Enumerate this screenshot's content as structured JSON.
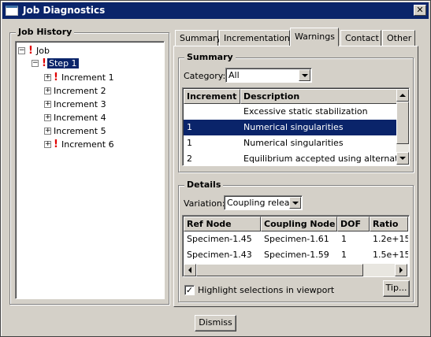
{
  "window": {
    "title": "Job Diagnostics",
    "close_glyph": "✕"
  },
  "job_history": {
    "label": "Job History",
    "tree": {
      "job": {
        "label": "Job",
        "toggle": "−",
        "warning": "!"
      },
      "step": {
        "label": "Step 1",
        "toggle": "−",
        "warning": "!"
      },
      "increments": [
        {
          "label": "Increment 1",
          "toggle": "+",
          "warning": "!"
        },
        {
          "label": "Increment 2",
          "toggle": "+",
          "warning": ""
        },
        {
          "label": "Increment 3",
          "toggle": "+",
          "warning": ""
        },
        {
          "label": "Increment 4",
          "toggle": "+",
          "warning": ""
        },
        {
          "label": "Increment 5",
          "toggle": "+",
          "warning": ""
        },
        {
          "label": "Increment 6",
          "toggle": "+",
          "warning": "!"
        }
      ]
    }
  },
  "tabs": [
    "Summary",
    "Incrementation",
    "Warnings",
    "Contact",
    "Other"
  ],
  "active_tab": "Warnings",
  "summary": {
    "label": "Summary",
    "category_label": "Category:",
    "category_value": "All",
    "columns": [
      "Increment",
      "Description"
    ],
    "rows": [
      {
        "increment": "",
        "description": "Excessive static stabilization"
      },
      {
        "increment": "1",
        "description": "Numerical singularities"
      },
      {
        "increment": "1",
        "description": "Numerical singularities"
      },
      {
        "increment": "2",
        "description": "Equilibrium accepted using alternate toler"
      }
    ],
    "selected_row": 1
  },
  "details": {
    "label": "Details",
    "variation_label": "Variation:",
    "variation_value": "Coupling release",
    "columns": [
      "Ref Node",
      "Coupling Node",
      "DOF",
      "Ratio"
    ],
    "rows": [
      {
        "ref_node": "Specimen-1.45",
        "coupling_node": "Specimen-1.61",
        "dof": "1",
        "ratio": "1.2e+15"
      },
      {
        "ref_node": "Specimen-1.43",
        "coupling_node": "Specimen-1.59",
        "dof": "1",
        "ratio": "1.5e+15"
      }
    ],
    "highlight_label": "Highlight selections in viewport",
    "highlight_checked": "✓",
    "tip_button": "Tip..."
  },
  "dismiss_button": "Dismiss",
  "colors": {
    "selection": "#0a246a",
    "warning": "#e00000",
    "face": "#d4d0c8"
  }
}
